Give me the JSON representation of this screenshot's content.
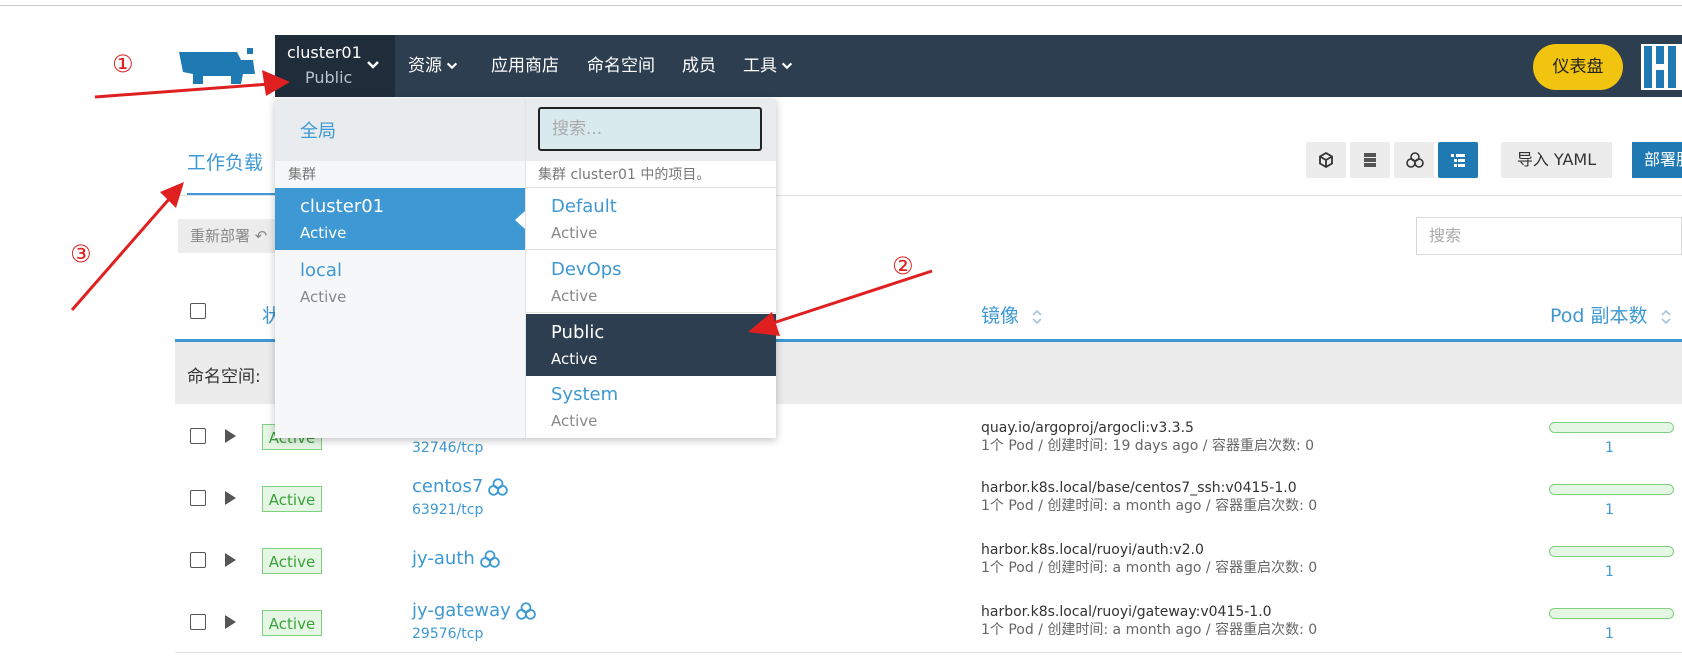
{
  "header": {
    "cluster_name": "cluster01",
    "project_name": "Public",
    "nav": [
      "资源",
      "应用商店",
      "命名空间",
      "成员",
      "工具"
    ],
    "dashboard_button": "仪表盘"
  },
  "page": {
    "tab": "工作负载",
    "import_yaml": "导入 YAML",
    "deploy": "部署服",
    "redeploy": "重新部署",
    "search_placeholder": "搜索",
    "columns": {
      "state": "状",
      "image": "镜像",
      "pods": "Pod 副本数"
    },
    "namespace_group": "命名空间: "
  },
  "workloads": [
    {
      "status": "Active",
      "name": "",
      "port": "32746/tcp",
      "image": "quay.io/argoproj/argocli:v3.3.5",
      "meta": "1个 Pod / 创建时间: 19 days ago / 容器重启次数: 0",
      "pods": "1"
    },
    {
      "status": "Active",
      "name": "centos7",
      "port": "63921/tcp",
      "image": "harbor.k8s.local/base/centos7_ssh:v0415-1.0",
      "meta": "1个 Pod / 创建时间: a month ago / 容器重启次数: 0",
      "pods": "1"
    },
    {
      "status": "Active",
      "name": "jy-auth",
      "port": "",
      "image": "harbor.k8s.local/ruoyi/auth:v2.0",
      "meta": "1个 Pod / 创建时间: a month ago / 容器重启次数: 0",
      "pods": "1"
    },
    {
      "status": "Active",
      "name": "jy-gateway",
      "port": "29576/tcp",
      "image": "harbor.k8s.local/ruoyi/gateway:v0415-1.0",
      "meta": "1个 Pod / 创建时间: a month ago / 容器重启次数: 0",
      "pods": "1"
    }
  ],
  "dropdown": {
    "global": "全局",
    "clusters_header": "集群",
    "search_placeholder": "搜索...",
    "projects_header": "集群 cluster01 中的项目。",
    "clusters": [
      {
        "name": "cluster01",
        "status": "Active"
      },
      {
        "name": "local",
        "status": "Active"
      }
    ],
    "projects": [
      {
        "name": "Default",
        "status": "Active"
      },
      {
        "name": "DevOps",
        "status": "Active"
      },
      {
        "name": "Public",
        "status": "Active"
      },
      {
        "name": "System",
        "status": "Active"
      }
    ]
  },
  "annotations": [
    "①",
    "②",
    "③"
  ],
  "colors": {
    "navbar": "#2d3e50",
    "accent": "#3d98d3",
    "dashboard": "#f1c40f",
    "arrow": "#e02020"
  }
}
